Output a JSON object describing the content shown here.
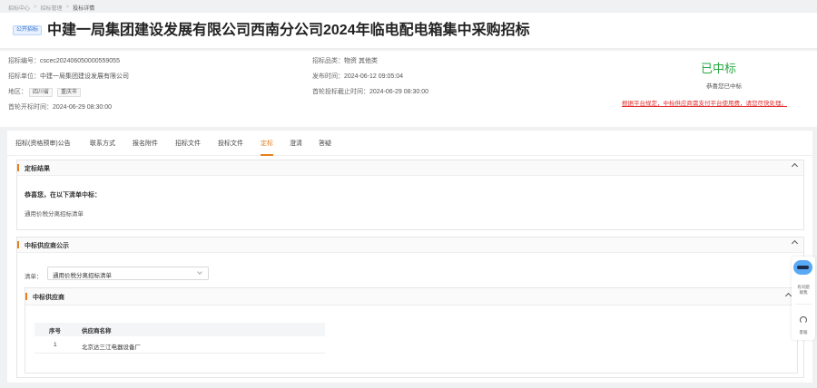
{
  "breadcrumb": {
    "items": [
      "招标中心",
      "招标管理",
      "投标详情"
    ]
  },
  "header": {
    "tag": "公开招标",
    "title": "中建一局集团建设发展有限公司西南分公司2024年临电配电箱集中采购招标"
  },
  "info": {
    "code_label": "招标编号：",
    "code_value": "cscec202406050000559055",
    "unit_label": "招标单位：",
    "unit_value": "中建一局集团建设发展有限公司",
    "region_label": "地区：",
    "region_values": [
      "四川省",
      "重庆市"
    ],
    "first_open_label": "首轮开标时间：",
    "first_open_value": "2024-06-29 08:30:00",
    "category_label": "招标品类：",
    "category_value": "物资 其他类",
    "publish_label": "发布时间：",
    "publish_value": "2024-06-12 09:05:04",
    "deadline_label": "首轮投标截止时间：",
    "deadline_value": "2024-06-29 08:30:00"
  },
  "status": {
    "result": "已中标",
    "congrats": "恭喜您已中标",
    "notice": "根据平台规定，中标供应商需支付平台使用费，请您尽快处理。"
  },
  "tabs": [
    "招标(资格预审)公告",
    "联系方式",
    "报名附件",
    "招标文件",
    "投标文件",
    "定标",
    "澄清",
    "答疑"
  ],
  "active_tab_index": 5,
  "result_section": {
    "title": "定标结果",
    "line1": "恭喜您，在以下清单中标：",
    "line2": "通用价税分离招标清单"
  },
  "supplier_section": {
    "title": "中标供应商公示",
    "list_label": "清单：",
    "list_selected": "通用价税分离招标清单",
    "sub_title": "中标供应商",
    "columns": [
      "序号",
      "供应商名称"
    ],
    "rows": [
      {
        "index": "1",
        "name": "北京达三江电器设备厂"
      }
    ]
  },
  "float_bar": {
    "help_label": "有问题\n联我",
    "service_label": "客服"
  },
  "colors": {
    "accent": "#e6801e",
    "success": "#2aa845",
    "warning": "#e02d2d"
  }
}
